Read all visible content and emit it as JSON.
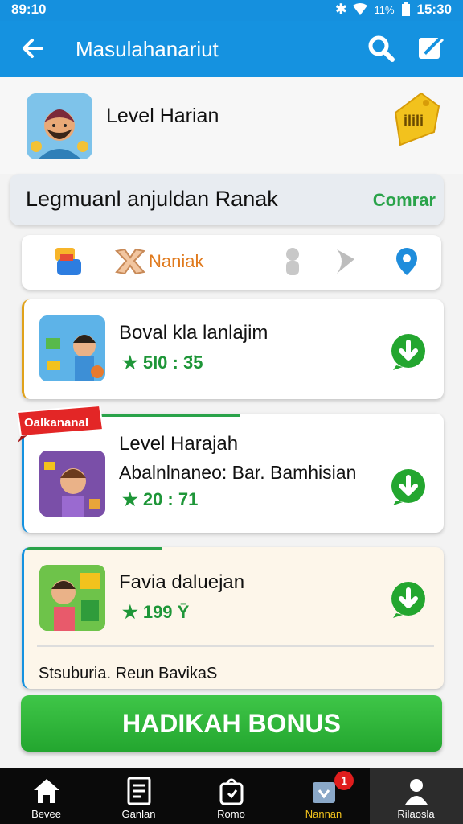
{
  "status_bar": {
    "time_left": "89:10",
    "battery": "11%",
    "time_right": "15:30"
  },
  "app_bar": {
    "title": "Masulahanariut"
  },
  "hero": {
    "title": "Level Harian",
    "tag_text": "ilili"
  },
  "promo": {
    "label": "Legmuanl anjuldan Ranak",
    "link": "Comrar"
  },
  "categories": {
    "label": "Naniak"
  },
  "cards": [
    {
      "name": "Boval kla lanlajim",
      "rating": "★ 5I0 : 3̈5"
    },
    {
      "ribbon": "Oalkananal",
      "name": "Level Harajah",
      "subtitle": "Abalnlnaneo: Bar. Bamhisian",
      "rating": "★ 20 : 71"
    },
    {
      "name": "Favia daluejan",
      "rating": "★ 199 Ȳ",
      "footer": "Stsuburia. Reun BavikaS"
    }
  ],
  "bonus_button": {
    "label": "HADIKAH BONUS"
  },
  "bottom_nav": {
    "items": [
      {
        "label": "Bevee",
        "icon": "home-icon"
      },
      {
        "label": "Ganlan",
        "icon": "document-icon"
      },
      {
        "label": "Romo",
        "icon": "bag-icon"
      },
      {
        "label": "Nannan",
        "icon": "shop-icon"
      },
      {
        "label": "Rilaosla",
        "icon": "profile-icon"
      }
    ],
    "notification_count": "1"
  },
  "colors": {
    "primary": "#1592e0",
    "accent_green": "#2aa34a",
    "button_green": "#23a62f",
    "rating_green": "#1e9638",
    "orange": "#e07a1d"
  }
}
